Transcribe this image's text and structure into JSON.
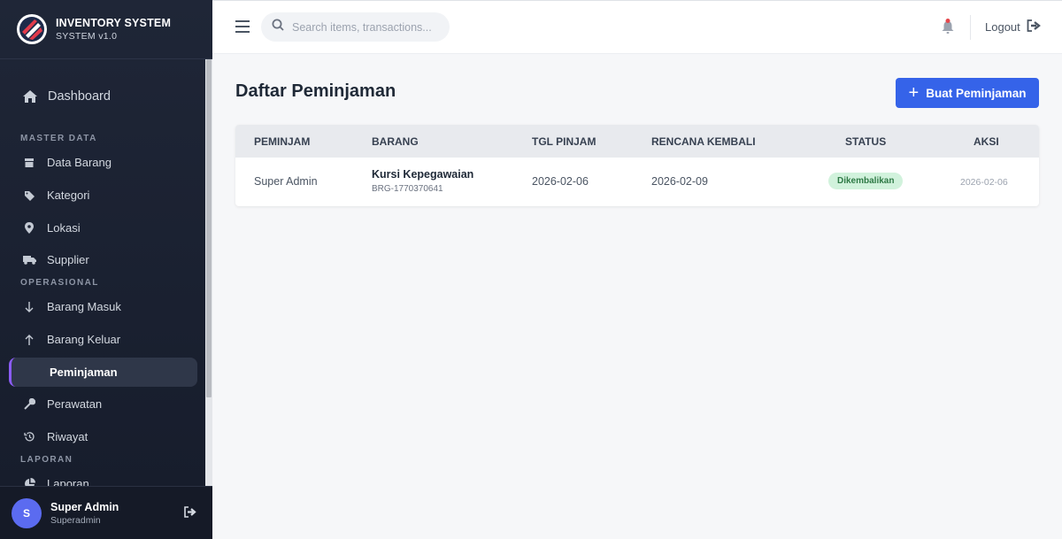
{
  "brand": {
    "title": "INVENTORY SYSTEM",
    "subtitle": "SYSTEM v1.0"
  },
  "sidebar": {
    "dashboard": "Dashboard",
    "sections": {
      "master": "MASTER DATA",
      "operasional": "OPERASIONAL",
      "laporan": "LAPORAN"
    },
    "items": [
      {
        "label": "Data Barang",
        "icon": "box-icon"
      },
      {
        "label": "Kategori",
        "icon": "tag-icon"
      },
      {
        "label": "Lokasi",
        "icon": "map-pin-icon"
      },
      {
        "label": "Supplier",
        "icon": "truck-icon"
      },
      {
        "label": "Barang Masuk",
        "icon": "arrow-down-icon"
      },
      {
        "label": "Barang Keluar",
        "icon": "arrow-up-icon"
      },
      {
        "label": "Peminjaman",
        "icon": "handshake-icon",
        "active": true
      },
      {
        "label": "Perawatan",
        "icon": "wrench-icon"
      },
      {
        "label": "Riwayat",
        "icon": "history-icon"
      },
      {
        "label": "Laporan",
        "icon": "pie-chart-icon"
      }
    ]
  },
  "user": {
    "initial": "S",
    "name": "Super Admin",
    "role": "Superadmin"
  },
  "topbar": {
    "search_placeholder": "Search items, transactions...",
    "logout": "Logout"
  },
  "page": {
    "title": "Daftar Peminjaman",
    "create_button": "Buat Peminjaman"
  },
  "table": {
    "columns": [
      "PEMINJAM",
      "BARANG",
      "TGL PINJAM",
      "RENCANA KEMBALI",
      "STATUS",
      "AKSI"
    ],
    "rows": [
      {
        "peminjam": "Super Admin",
        "barang": "Kursi Kepegawaian",
        "kode": "BRG-1770370641",
        "tgl_pinjam": "2026-02-06",
        "rencana_kembali": "2026-02-09",
        "status": "Dikembalikan",
        "aksi": "2026-02-06"
      }
    ]
  },
  "colors": {
    "accent": "#3563e9",
    "active_border": "#8b5cf6",
    "sidebar_bg": "#1f2637",
    "status_bg": "#d1f2dc",
    "status_text": "#2f7a46"
  }
}
